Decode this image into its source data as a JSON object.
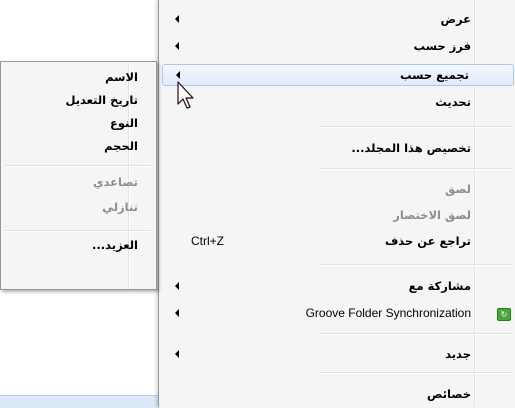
{
  "menu": {
    "items": [
      {
        "label": "عرض",
        "arrow": true
      },
      {
        "label": "فرز حسب",
        "arrow": true
      },
      {
        "label": "تجميع حسب",
        "arrow": true
      },
      {
        "label": "تحديث",
        "arrow": false
      },
      {
        "label": "تخصيص هذا المجلد...",
        "arrow": false
      },
      {
        "label": "لصق",
        "arrow": false,
        "disabled": true
      },
      {
        "label": "لصق الاختصار",
        "arrow": false,
        "disabled": true
      },
      {
        "label": "تراجع عن حذف",
        "arrow": false,
        "shortcut": "Ctrl+Z"
      },
      {
        "label": "مشاركة مع",
        "arrow": true
      },
      {
        "label": "Groove Folder Synchronization",
        "arrow": true,
        "icon": "groove-sync-icon"
      },
      {
        "label": "جديد",
        "arrow": true
      },
      {
        "label": "خصائص",
        "arrow": false
      }
    ]
  },
  "submenu": {
    "items": [
      {
        "label": "الاسم"
      },
      {
        "label": "تاريخ التعديل"
      },
      {
        "label": "النوع"
      },
      {
        "label": "الحجم"
      },
      {
        "label": "تصاعدي",
        "disabled": true
      },
      {
        "label": "تنازلي",
        "disabled": true
      },
      {
        "label": "العزيد..."
      }
    ]
  },
  "colors": {
    "menu_bg": "#f5f5f5",
    "hover_border": "#a8c8ee",
    "disabled_text": "#8d8d8d"
  }
}
